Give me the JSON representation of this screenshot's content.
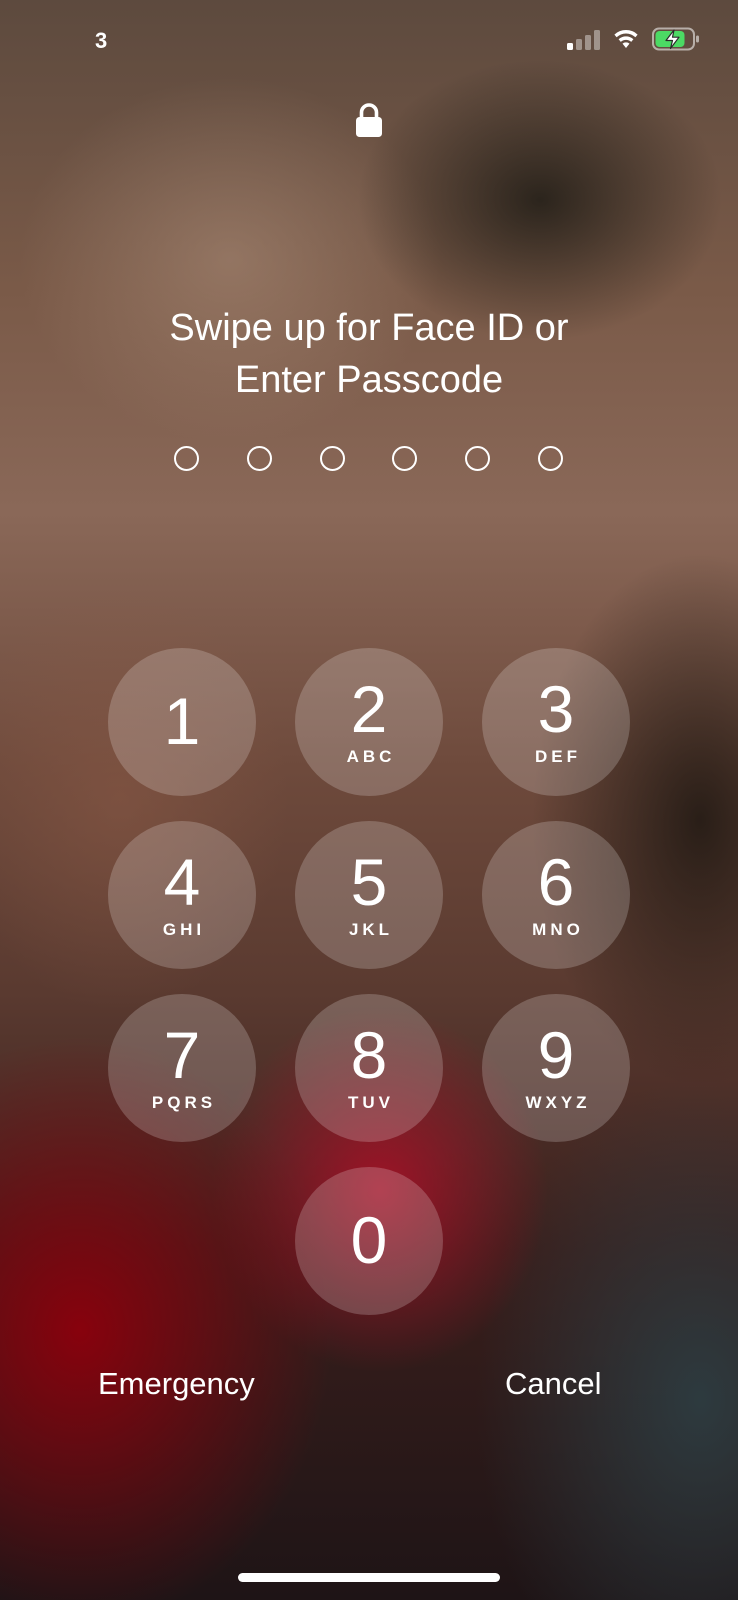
{
  "status_bar": {
    "carrier": "3",
    "signal_bars_active": 1,
    "signal_bars_total": 4,
    "battery": {
      "state": "charging",
      "level": 0.8,
      "color": "#4cd964"
    }
  },
  "lock": {
    "icon": "lock-icon"
  },
  "prompt": {
    "line1": "Swipe up for Face ID or",
    "line2": "Enter Passcode"
  },
  "passcode": {
    "length": 6,
    "entered": 0
  },
  "keypad": [
    {
      "digit": "1",
      "letters": ""
    },
    {
      "digit": "2",
      "letters": "ABC"
    },
    {
      "digit": "3",
      "letters": "DEF"
    },
    {
      "digit": "4",
      "letters": "GHI"
    },
    {
      "digit": "5",
      "letters": "JKL"
    },
    {
      "digit": "6",
      "letters": "MNO"
    },
    {
      "digit": "7",
      "letters": "PQRS"
    },
    {
      "digit": "8",
      "letters": "TUV"
    },
    {
      "digit": "9",
      "letters": "WXYZ"
    },
    {
      "digit": "0",
      "letters": ""
    }
  ],
  "actions": {
    "emergency_label": "Emergency",
    "cancel_label": "Cancel"
  }
}
